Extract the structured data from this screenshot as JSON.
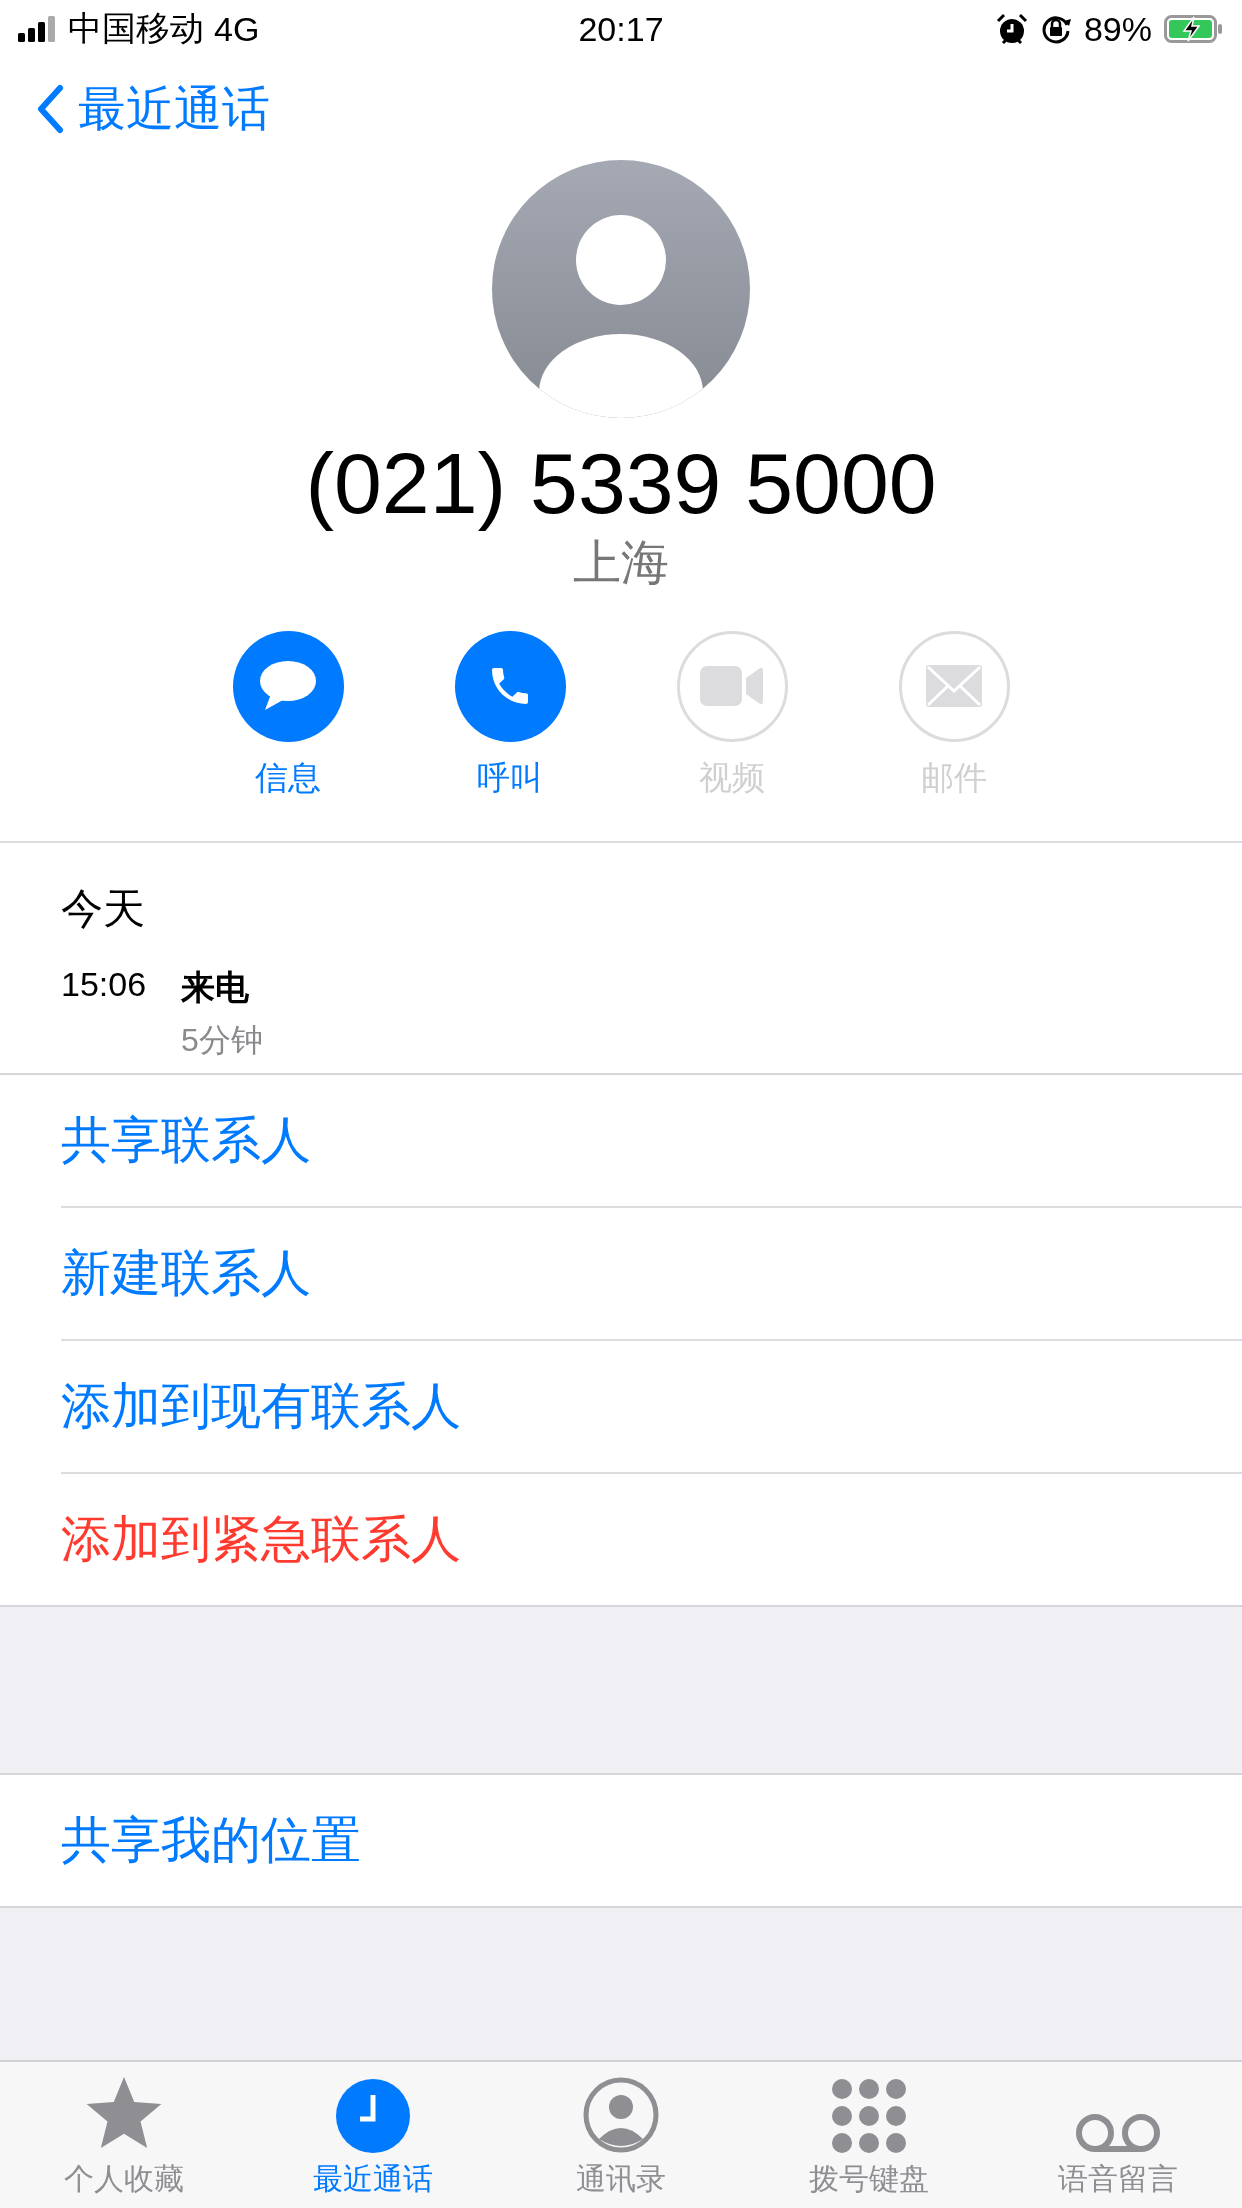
{
  "status_bar": {
    "carrier": "中国移动",
    "network": "4G",
    "time": "20:17",
    "battery": "89%"
  },
  "nav": {
    "back_label": "最近通话"
  },
  "contact": {
    "number": "(021) 5339 5000",
    "location": "上海"
  },
  "actions": [
    {
      "kind": "message",
      "label": "信息",
      "disabled": false
    },
    {
      "kind": "call",
      "label": "呼叫",
      "disabled": false
    },
    {
      "kind": "video",
      "label": "视频",
      "disabled": true
    },
    {
      "kind": "mail",
      "label": "邮件",
      "disabled": true
    }
  ],
  "history": {
    "date": "今天",
    "entries": [
      {
        "time": "15:06",
        "type": "来电",
        "duration": "5分钟"
      }
    ]
  },
  "menu_groups": [
    [
      {
        "label": "共享联系人",
        "kind": "normal"
      },
      {
        "label": "新建联系人",
        "kind": "normal"
      },
      {
        "label": "添加到现有联系人",
        "kind": "normal"
      },
      {
        "label": "添加到紧急联系人",
        "kind": "destructive"
      }
    ],
    [
      {
        "label": "共享我的位置",
        "kind": "normal"
      }
    ]
  ],
  "tabs": [
    {
      "kind": "favorites",
      "label": "个人收藏",
      "selected": false
    },
    {
      "kind": "recents",
      "label": "最近通话",
      "selected": true
    },
    {
      "kind": "contacts",
      "label": "通讯录",
      "selected": false
    },
    {
      "kind": "keypad",
      "label": "拨号键盘",
      "selected": false
    },
    {
      "kind": "voicemail",
      "label": "语音留言",
      "selected": false
    }
  ]
}
